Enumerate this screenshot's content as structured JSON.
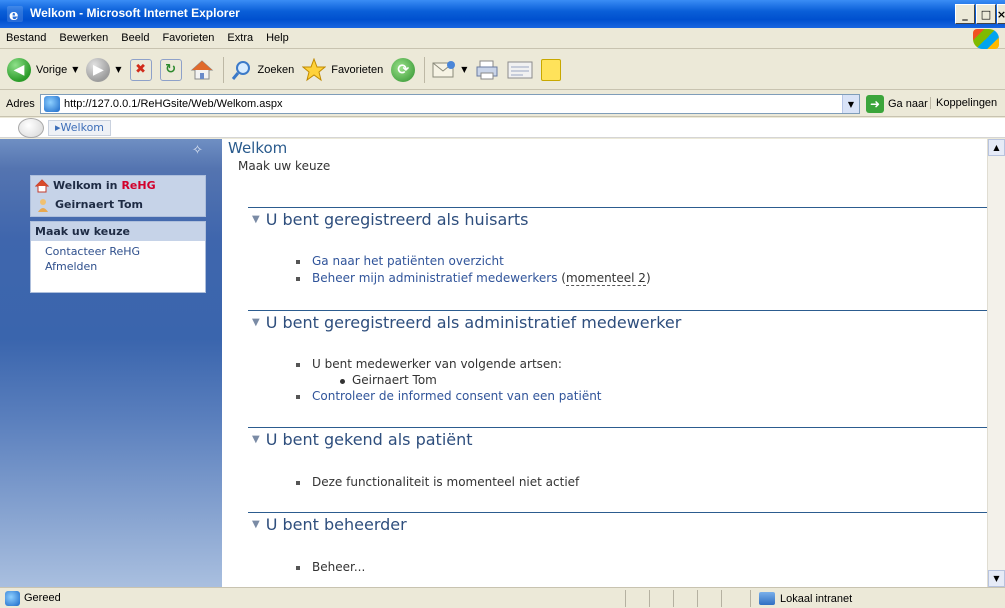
{
  "window": {
    "title": "Welkom - Microsoft Internet Explorer",
    "controls": [
      "_",
      "□",
      "×"
    ]
  },
  "menu": {
    "items": [
      "Bestand",
      "Bewerken",
      "Beeld",
      "Favorieten",
      "Extra",
      "Help"
    ]
  },
  "toolbar": {
    "back_label": "Vorige",
    "search_label": "Zoeken",
    "favorites_label": "Favorieten"
  },
  "address": {
    "label": "Adres",
    "url": "http://127.0.0.1/ReHGsite/Web/Welkom.aspx",
    "go_label": "Ga naar",
    "links_label": "Koppelingen"
  },
  "breadcrumb": {
    "current": "Welkom"
  },
  "sidebar": {
    "welcome_prefix": "Welkom in",
    "brand": "ReHG",
    "user_name": "Geirnaert Tom",
    "menu_header": "Maak uw keuze",
    "links": [
      "Contacteer ReHG",
      "Afmelden"
    ]
  },
  "main": {
    "title": "Welkom",
    "subtitle": "Maak uw keuze",
    "sections": {
      "huisarts": {
        "heading": "U bent geregistreerd als huisarts",
        "link_patients": "Ga naar het patiënten overzicht",
        "link_manage": "Beheer mijn administratief medewerkers",
        "count_open": "(",
        "count_text": "momenteel 2",
        "count_close": ")"
      },
      "admin": {
        "heading": "U bent geregistreerd als administratief medewerker",
        "employee_of": "U bent medewerker van volgende artsen:",
        "doctor": "Geirnaert Tom",
        "link_consent": "Controleer de informed consent van een patiënt"
      },
      "patient": {
        "heading": "U bent gekend als patiënt",
        "inactive": "Deze functionaliteit is momenteel niet actief"
      },
      "beheerder": {
        "heading": "U bent beheerder",
        "item": "Beheer..."
      }
    }
  },
  "status": {
    "text": "Gereed",
    "zone": "Lokaal intranet"
  },
  "colors": {
    "titlebar": "#0050cf",
    "sidebar": "#3f66ad",
    "heading": "#2e4e7d",
    "link": "#30549a",
    "brand": "#d2002b"
  }
}
